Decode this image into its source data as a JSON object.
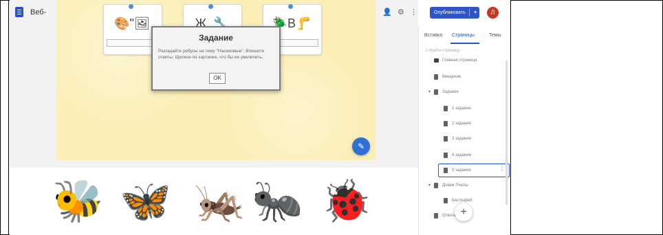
{
  "app": {
    "site_title": "Веб-",
    "publish_label": "Опубликовать",
    "publish_arrow": "▾",
    "avatar_letter": "Л",
    "icons": [
      "add-person-icon",
      "settings-icon",
      "more-vert-icon"
    ]
  },
  "dialog": {
    "title": "Задание",
    "text": "Разгадайте ребусы на тему \"Насекомые\". Впишите ответы. Щелкни по картинке, что бы ее увеличить.",
    "ok_label": "OK"
  },
  "rebus_cards": [
    {
      "glyphs": "🎨\"🖼"
    },
    {
      "glyphs": "Ж_🔧"
    },
    {
      "glyphs": "🪲В🦵"
    }
  ],
  "insects": [
    "🐝",
    "🦋",
    "🦗",
    "🐜",
    "🐞"
  ],
  "panel": {
    "tabs": [
      "Вставка",
      "Страницы",
      "Темы"
    ],
    "active_tab": "Страницы",
    "search_placeholder": "Найти страницу",
    "add_label": "+",
    "pages": [
      {
        "label": "Главная страница",
        "level": 0,
        "caret": "",
        "home": true
      },
      {
        "label": "Введение",
        "level": 0,
        "caret": ""
      },
      {
        "label": "Задания",
        "level": 0,
        "caret": "▾"
      },
      {
        "label": "1 задание",
        "level": 1,
        "caret": ""
      },
      {
        "label": "2 задание",
        "level": 1,
        "caret": ""
      },
      {
        "label": "3 задание",
        "level": 1,
        "caret": ""
      },
      {
        "label": "4 задание",
        "level": 1,
        "caret": ""
      },
      {
        "label": "5 задание",
        "level": 1,
        "caret": "",
        "selected": true
      },
      {
        "label": "Домик Пчелы",
        "level": 0,
        "caret": "▾"
      },
      {
        "label": "Бестиарий",
        "level": 1,
        "caret": ""
      },
      {
        "label": "Ответы",
        "level": 0,
        "caret": ""
      }
    ]
  },
  "colors": {
    "accent": "#2e54c6",
    "avatar": "#c8361c",
    "canvas_yellow": "#fbefb7"
  }
}
